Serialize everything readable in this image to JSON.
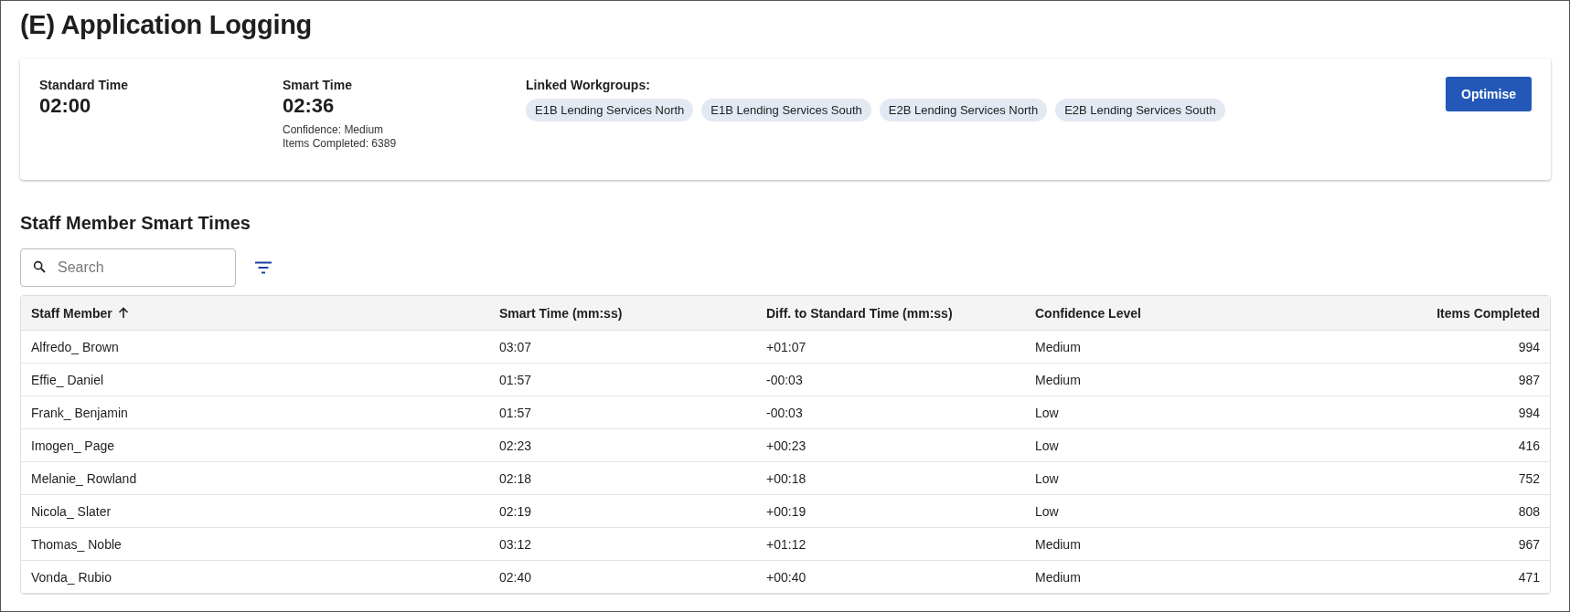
{
  "title": "(E) Application Logging",
  "summary": {
    "standard_time": {
      "label": "Standard Time",
      "value": "02:00"
    },
    "smart_time": {
      "label": "Smart Time",
      "value": "02:36",
      "confidence": "Confidence: Medium",
      "items_completed": "Items Completed: 6389"
    },
    "linked_workgroups": {
      "label": "Linked Workgroups:",
      "chips": [
        "E1B Lending Services North",
        "E1B Lending Services South",
        "E2B Lending Services North",
        "E2B Lending Services South"
      ]
    },
    "button": "Optimise"
  },
  "section_title": "Staff Member Smart Times",
  "search": {
    "placeholder": "Search"
  },
  "table": {
    "columns": [
      {
        "label": "Staff Member",
        "sorted": true
      },
      {
        "label": "Smart Time (mm:ss)",
        "sorted": false
      },
      {
        "label": "Diff. to Standard Time (mm:ss)",
        "sorted": false
      },
      {
        "label": "Confidence Level",
        "sorted": false
      },
      {
        "label": "Items Completed",
        "sorted": false
      }
    ],
    "rows": [
      [
        "Alfredo_ Brown",
        "03:07",
        "+01:07",
        "Medium",
        "994"
      ],
      [
        "Effie_ Daniel",
        "01:57",
        "-00:03",
        "Medium",
        "987"
      ],
      [
        "Frank_ Benjamin",
        "01:57",
        "-00:03",
        "Low",
        "994"
      ],
      [
        "Imogen_ Page",
        "02:23",
        "+00:23",
        "Low",
        "416"
      ],
      [
        "Melanie_ Rowland",
        "02:18",
        "+00:18",
        "Low",
        "752"
      ],
      [
        "Nicola_ Slater",
        "02:19",
        "+00:19",
        "Low",
        "808"
      ],
      [
        "Thomas_ Noble",
        "03:12",
        "+01:12",
        "Medium",
        "967"
      ],
      [
        "Vonda_ Rubio",
        "02:40",
        "+00:40",
        "Medium",
        "471"
      ]
    ]
  }
}
